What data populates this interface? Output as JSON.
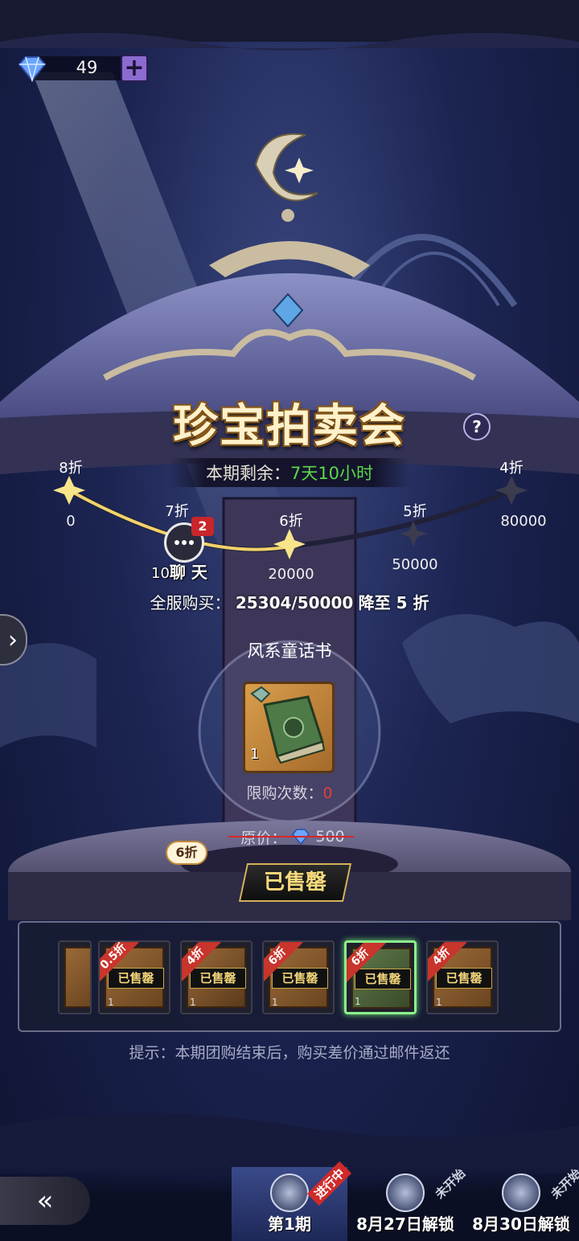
{
  "currency": {
    "gem_count": "49",
    "icon": "diamond-icon",
    "add_icon": "plus-icon"
  },
  "event": {
    "title": "珍宝拍卖会",
    "help_icon": "question-icon",
    "remaining_label": "本期剩余：",
    "remaining_value": "7天10小时"
  },
  "discount_track": {
    "ticks": [
      {
        "discount": "8折",
        "threshold": "0"
      },
      {
        "discount": "7折",
        "threshold": "10000"
      },
      {
        "discount": "6折",
        "threshold": "20000"
      },
      {
        "discount": "5折",
        "threshold": "50000"
      },
      {
        "discount": "4折",
        "threshold": "80000"
      }
    ],
    "reached_ticks": 3,
    "progress": 25304,
    "goal": 50000
  },
  "chat": {
    "label": "聊 天",
    "badge": "2",
    "prefix": "10"
  },
  "server_purchase": {
    "label": "全服购买：",
    "current": "25304/50000",
    "suffix": "降至 5 折"
  },
  "featured_item": {
    "name": "风系童话书",
    "quantity": "1",
    "limit_label": "限购次数：",
    "limit_value": "0",
    "price_label": "原价：",
    "price_value": "500",
    "discount_badge": "6折",
    "status": "已售罄"
  },
  "carousel": {
    "items": [
      {
        "ribbon": "",
        "status": "",
        "qty": ""
      },
      {
        "ribbon": "0.5折",
        "status": "已售罄",
        "qty": "1"
      },
      {
        "ribbon": "4折",
        "status": "已售罄",
        "qty": "1"
      },
      {
        "ribbon": "6折",
        "status": "已售罄",
        "qty": "1"
      },
      {
        "ribbon": "6折",
        "status": "已售罄",
        "qty": "1"
      },
      {
        "ribbon": "4折",
        "status": "已售罄",
        "qty": "1"
      }
    ],
    "selected_index": 4
  },
  "tip": "提示：本期团购结束后，购买差价通过邮件返还",
  "nav": {
    "side_arrow": "›",
    "back_icon": "back-arrow-icon"
  },
  "periods": [
    {
      "label": "第1期",
      "tag": "进行中"
    },
    {
      "label": "8月27日解锁",
      "tag": "未开始"
    },
    {
      "label": "8月30日解锁",
      "tag": "未开始"
    }
  ]
}
